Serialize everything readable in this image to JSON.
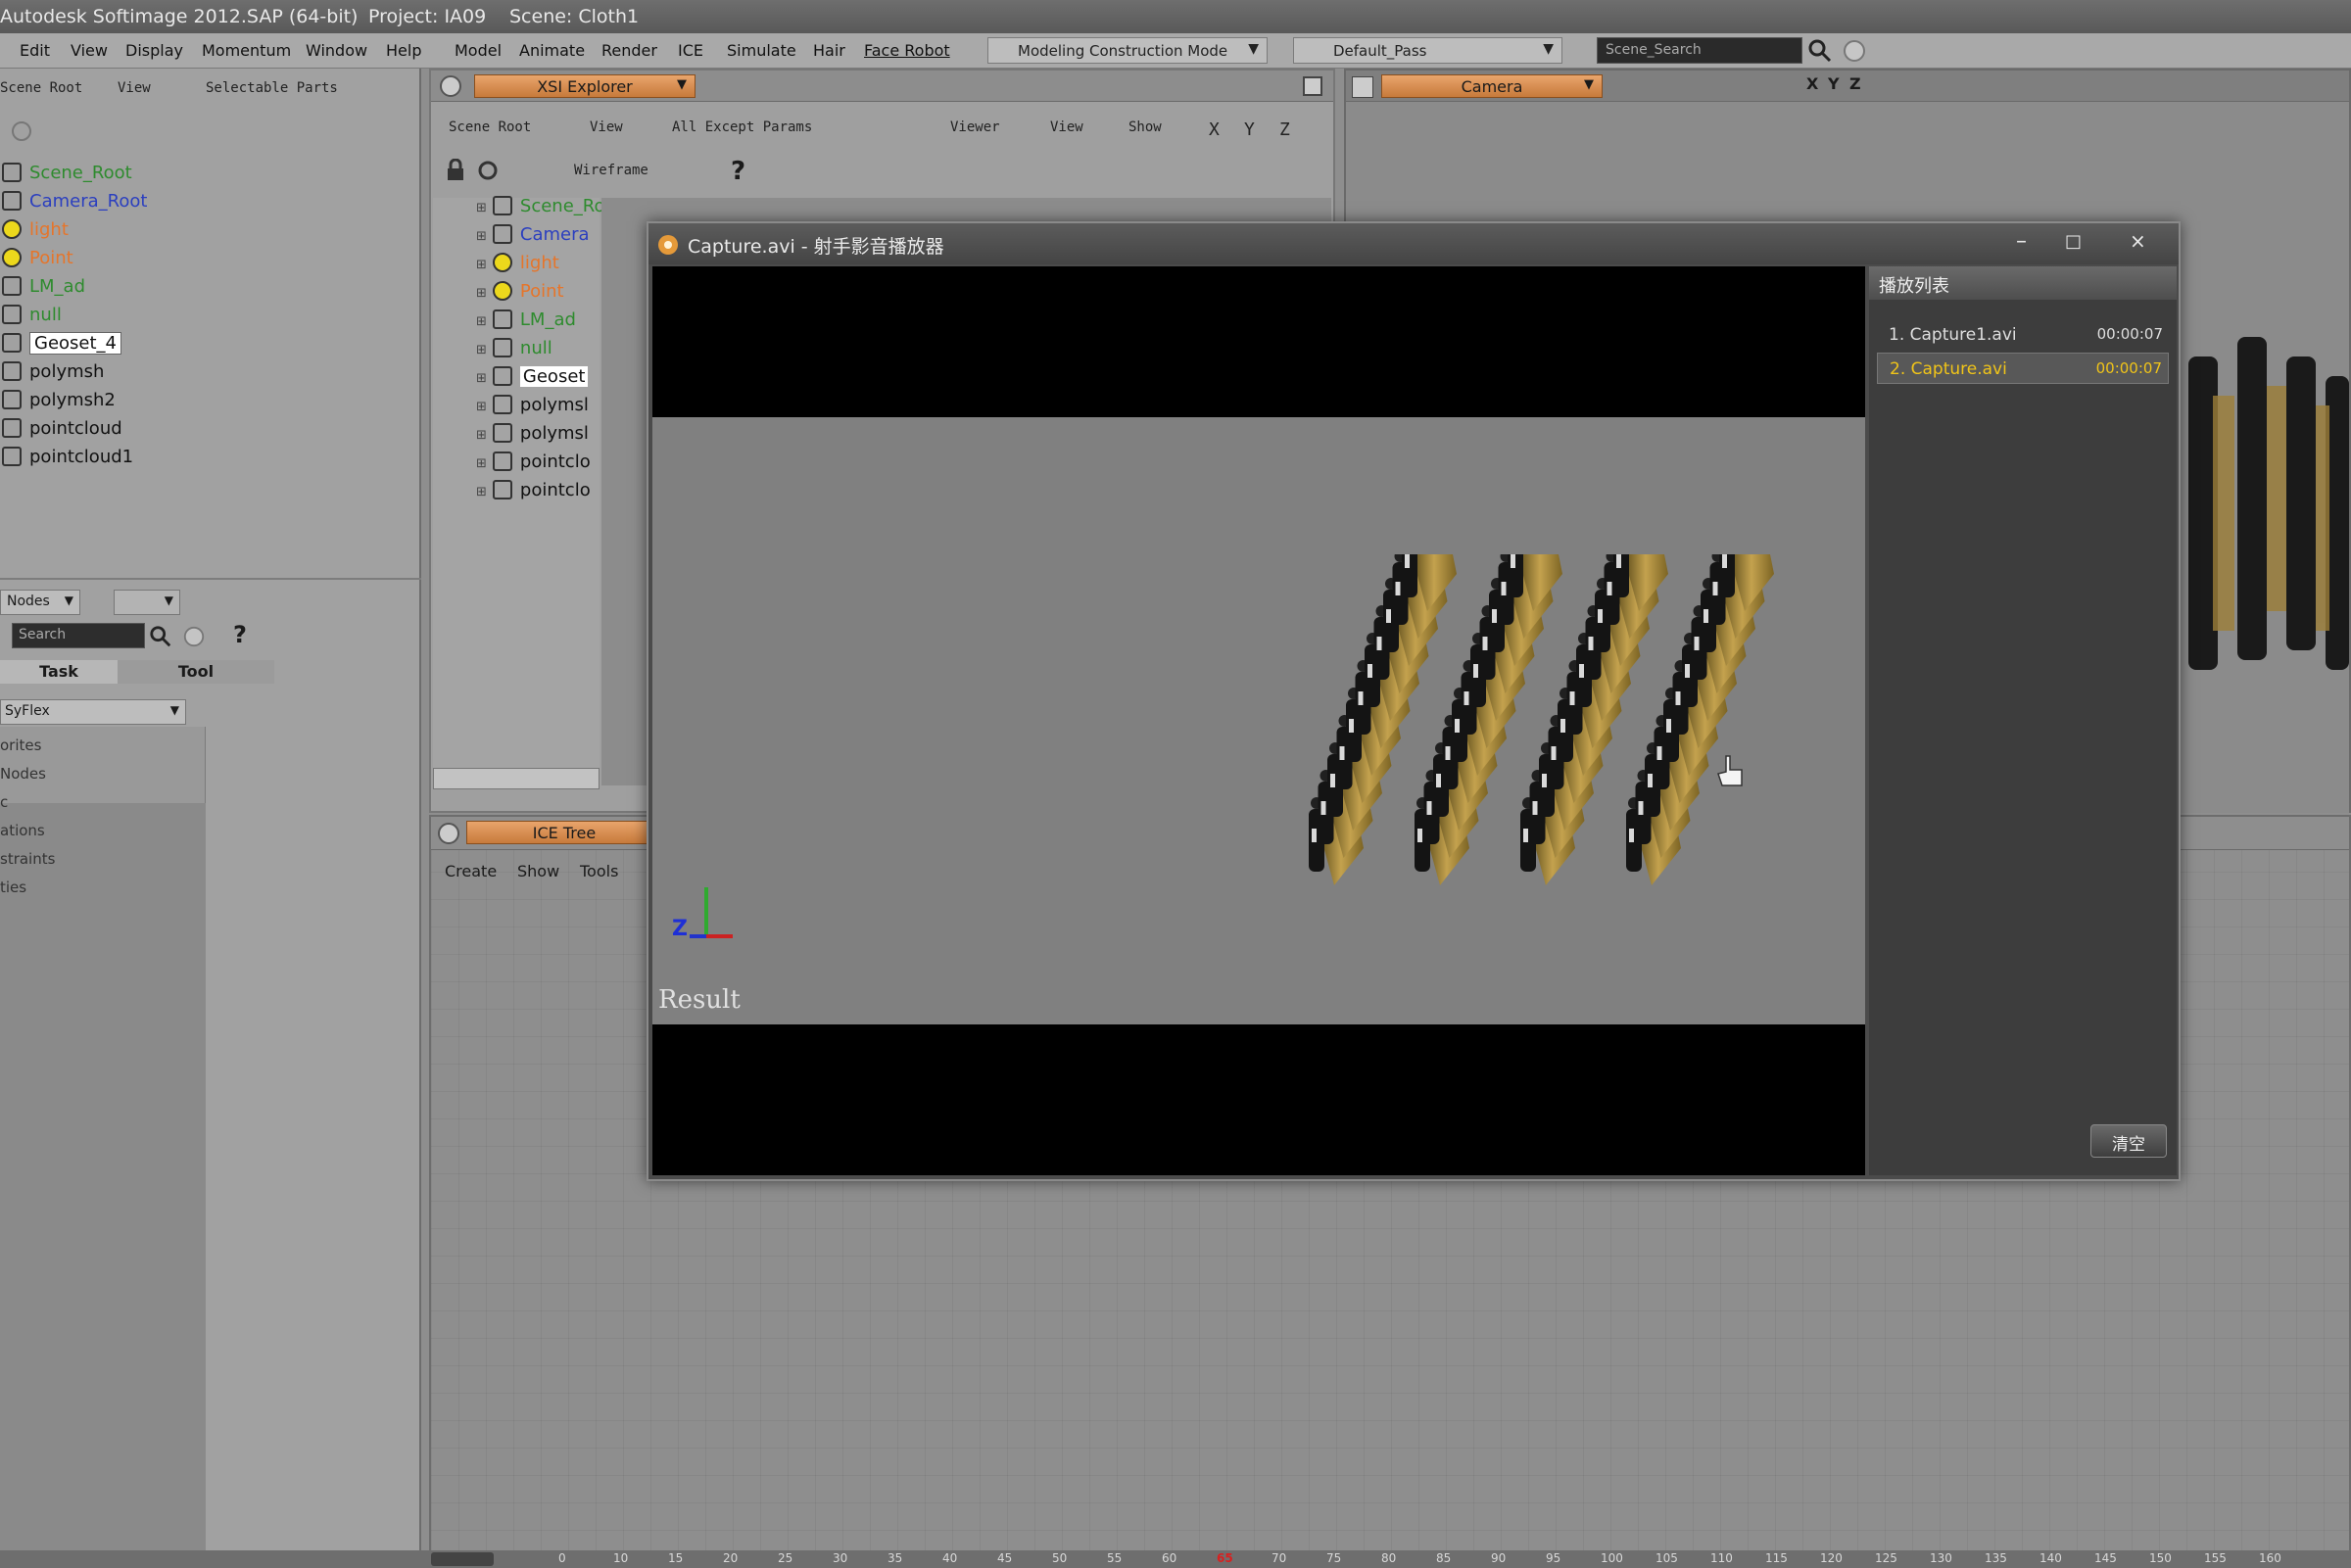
{
  "titlebar": {
    "app_title": "Autodesk Softimage 2012.SAP (64-bit)",
    "project": "Project: IA09",
    "scene": "Scene: Cloth1"
  },
  "menubar": {
    "items": [
      "Edit",
      "View",
      "Display",
      "Momentum",
      "Window",
      "Help",
      "Model",
      "Animate",
      "Render",
      "ICE",
      "Simulate",
      "Hair",
      "Face Robot"
    ],
    "mode_dropdown": "Modeling Construction Mode",
    "pass_dropdown": "Default_Pass",
    "search_placeholder": "Scene_Search"
  },
  "left_panel": {
    "toolbar": [
      "Scene Root",
      "View",
      "Selectable Parts"
    ],
    "tree": [
      {
        "label": "Scene_Root",
        "color": "#2e8b2e"
      },
      {
        "label": "Camera_Root",
        "color": "#2b3fbf"
      },
      {
        "label": "light",
        "color": "#e6752a"
      },
      {
        "label": "Point",
        "color": "#e6752a"
      },
      {
        "label": "LM_ad",
        "color": "#2e8b2e"
      },
      {
        "label": "null",
        "color": "#2e8b2e"
      },
      {
        "label": "Geoset_4",
        "color": "#111111"
      },
      {
        "label": "polymsh",
        "color": "#111111"
      },
      {
        "label": "polymsh2",
        "color": "#111111"
      },
      {
        "label": "pointcloud",
        "color": "#111111"
      },
      {
        "label": "pointcloud1",
        "color": "#111111"
      }
    ],
    "nodes_dropdown": "Nodes",
    "search_placeholder": "Search",
    "help_icon": "?",
    "tabs": [
      "Task",
      "Tool"
    ],
    "category_dropdown": "SyFlex",
    "categories": [
      "orites",
      "Nodes",
      "c",
      "ations",
      "straints",
      "ties"
    ]
  },
  "explorer": {
    "title": "XSI Explorer",
    "toolbar": [
      "Scene Root",
      "View",
      "All Except Params",
      "Viewer",
      "View",
      "Show",
      "X",
      "Y",
      "Z"
    ],
    "wireframe": "Wireframe",
    "help_icon": "?",
    "tree": [
      {
        "label": "Scene_Roc",
        "color": "#2e8b2e"
      },
      {
        "label": "Camera",
        "color": "#2b3fbf"
      },
      {
        "label": "light",
        "color": "#e6752a"
      },
      {
        "label": "Point",
        "color": "#e6752a"
      },
      {
        "label": "LM_ad",
        "color": "#2e8b2e"
      },
      {
        "label": "null",
        "color": "#2e8b2e"
      },
      {
        "label": "Geoset",
        "color": "#111111"
      },
      {
        "label": "polymsl",
        "color": "#111111"
      },
      {
        "label": "polymsl",
        "color": "#111111"
      },
      {
        "label": "pointclo",
        "color": "#111111"
      },
      {
        "label": "pointclo",
        "color": "#111111"
      }
    ]
  },
  "camera": {
    "tab": "Camera",
    "axes": [
      "X",
      "Y",
      "Z"
    ]
  },
  "icetree": {
    "tab": "ICE Tree",
    "menu": [
      "Create",
      "Show",
      "Tools"
    ]
  },
  "player": {
    "title": "Capture.avi - 射手影音播放器",
    "playlist_title": "播放列表",
    "playlist": [
      {
        "name": "1. Capture1.avi",
        "duration": "00:00:07",
        "active": false
      },
      {
        "name": "2. Capture.avi",
        "duration": "00:00:07",
        "active": true
      }
    ],
    "clear_button": "清空",
    "viewport_label": "Result",
    "axis_label": "Z"
  },
  "timeline": {
    "ticks": [
      "0",
      "10",
      "15",
      "20",
      "25",
      "30",
      "35",
      "40",
      "45",
      "50",
      "55",
      "60",
      "65",
      "70",
      "75",
      "80",
      "85",
      "90",
      "95",
      "100",
      "105",
      "110",
      "115",
      "120",
      "125",
      "130",
      "135",
      "140",
      "145",
      "150",
      "155",
      "160"
    ],
    "current_frame": "65",
    "current_color": "#d82020"
  }
}
